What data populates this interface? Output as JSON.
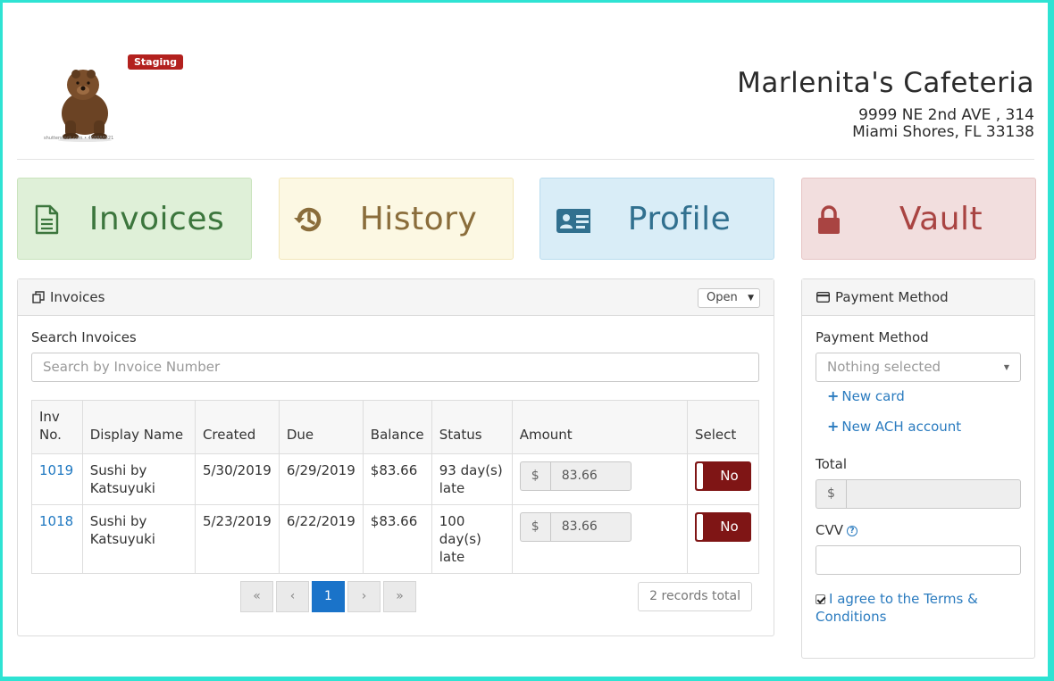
{
  "header": {
    "badge": "Staging",
    "logo_caption": "shutterstock.com • 468888521",
    "business_name": "Marlenita's Cafeteria",
    "address_line1": "9999 NE 2nd AVE , 314",
    "address_line2": "Miami Shores, FL 33138"
  },
  "nav": {
    "invoices": "Invoices",
    "history": "History",
    "profile": "Profile",
    "vault": "Vault"
  },
  "colors": {
    "invoices_tile": "#dff0d8",
    "history_tile": "#fcf8e3",
    "profile_tile": "#d9edf7",
    "vault_tile": "#f2dede",
    "toggle_no": "#7f1515",
    "accent_blue": "#1a73c9"
  },
  "invoices_panel": {
    "title": "Invoices",
    "status_filter": "Open",
    "search_label": "Search Invoices",
    "search_placeholder": "Search by Invoice Number",
    "columns": [
      "Inv No.",
      "Display Name",
      "Created",
      "Due",
      "Balance",
      "Status",
      "Amount",
      "Select"
    ],
    "rows": [
      {
        "inv_no": "1019",
        "display_name": "Sushi by Katsuyuki",
        "created": "5/30/2019",
        "due": "6/29/2019",
        "balance": "$83.66",
        "status": "93 day(s) late",
        "currency": "$",
        "amount": "83.66",
        "select": "No"
      },
      {
        "inv_no": "1018",
        "display_name": "Sushi by Katsuyuki",
        "created": "5/23/2019",
        "due": "6/22/2019",
        "balance": "$83.66",
        "status": "100 day(s) late",
        "currency": "$",
        "amount": "83.66",
        "select": "No"
      }
    ],
    "pagination": {
      "first": "«",
      "prev": "‹",
      "current": "1",
      "next": "›",
      "last": "»"
    },
    "records_total": "2 records total"
  },
  "payment_panel": {
    "title": "Payment Method",
    "method_label": "Payment Method",
    "method_value": "Nothing selected",
    "new_card": "New card",
    "new_ach": "New ACH account",
    "total_label": "Total",
    "total_currency": "$",
    "cvv_label": "CVV",
    "agree_text": "I agree to the Terms & Conditions"
  }
}
